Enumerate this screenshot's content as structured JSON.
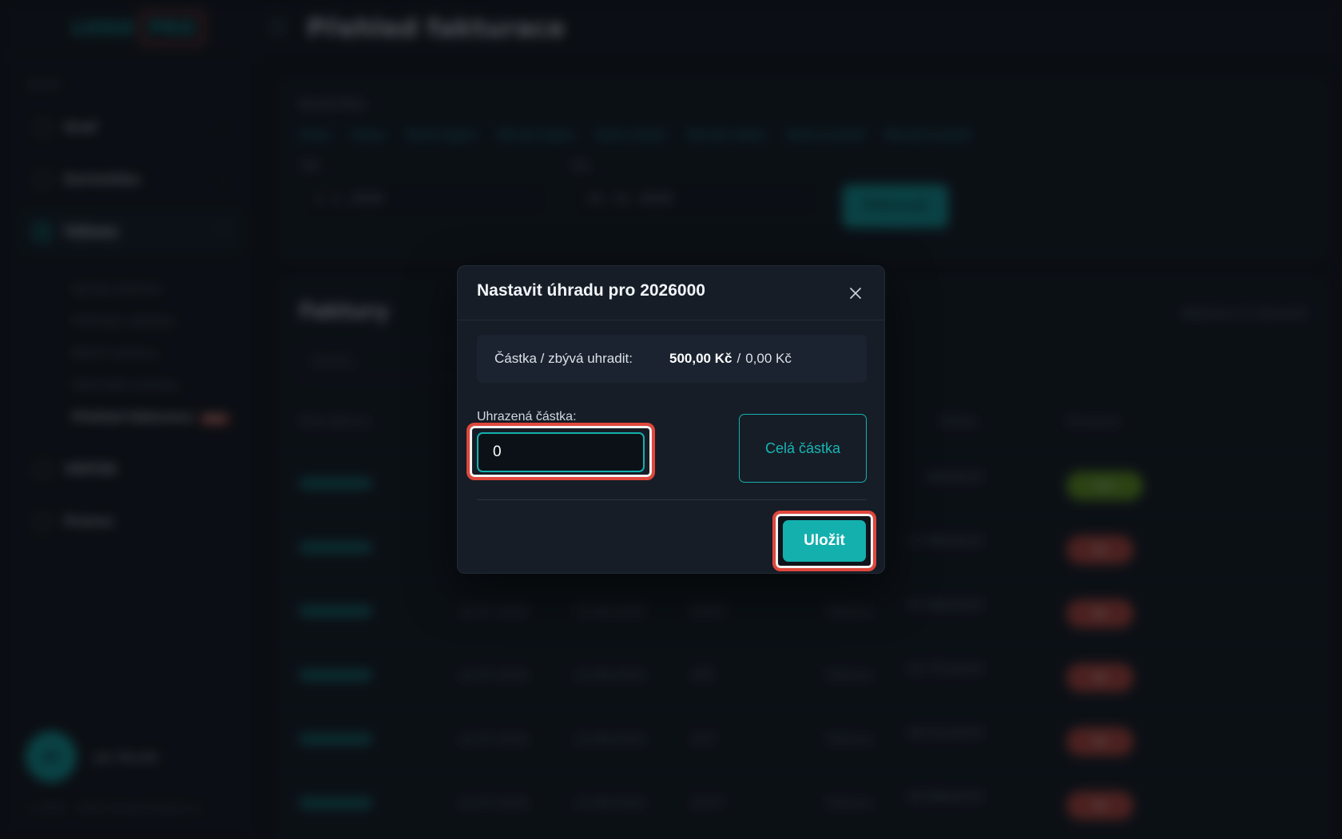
{
  "app": {
    "logo_text": "LOGO",
    "logo_badge": "PRO",
    "page_title": "Přehled fakturace"
  },
  "sidebar": {
    "section_label": "ADMIN",
    "items": [
      {
        "label": "Graf",
        "icon": "chart-icon"
      },
      {
        "label": "Kartotéka",
        "icon": "folder-icon"
      },
      {
        "label": "Výkazy",
        "icon": "report-icon"
      },
      {
        "label": "VRPÚD",
        "icon": "list-icon"
      },
      {
        "label": "Pomoc",
        "icon": "help-icon"
      }
    ],
    "sub_items": [
      {
        "label": "Rychlý přehled"
      },
      {
        "label": "Přehledy zakázky"
      },
      {
        "label": "Bloční sestavy"
      },
      {
        "label": "Obchodní sestavy"
      },
      {
        "label": "Přehled fakturace",
        "badge": "NEW"
      }
    ],
    "user": {
      "initials": "JN",
      "name": "Jan Novák"
    },
    "copyright": "© 2023 – 2026 Cloudovéřešení.cz"
  },
  "filters": {
    "quick_label": "Rychlé filtry",
    "quick_links": [
      "Dnes",
      "Včera",
      "Tento týden",
      "Minulý týden",
      "Tento měsíc",
      "Minulý měsíc",
      "Tento kvartál",
      "Minulý kvartál"
    ],
    "from_label": "Od:",
    "from_value": "1. 1. 2026",
    "to_label": "Do:",
    "to_value": "31. 12. 2026",
    "filter_button": "Filtrovat"
  },
  "invoices": {
    "title": "Faktury",
    "count": "Nalezeno 17 záznamů",
    "search_placeholder": "Hledat...",
    "columns": [
      "Číslo faktury",
      "Částka",
      "Uhrazeno"
    ],
    "rows": [
      {
        "col1": "",
        "col2": "",
        "col3": "",
        "type": "",
        "amount": "500,00 Kč",
        "status": "Ano",
        "status_color": "green"
      },
      {
        "col1": "",
        "col2": "",
        "col3": "",
        "type": "",
        "amount": "17 385,00 Kč",
        "status": "Ne",
        "status_color": "red"
      },
      {
        "col1": "22.07.2026",
        "col2": "22.08.2026",
        "col3": "ZHHV",
        "type": "Faktura",
        "amount": "41 000,00 Kč",
        "status": "Ne",
        "status_color": "red"
      },
      {
        "col1": "22.07.2026",
        "col2": "22.08.2026",
        "col3": "ZPE",
        "type": "Faktura",
        "amount": "41 770,00 Kč",
        "status": "Ne",
        "status_color": "red"
      },
      {
        "col1": "22.07.2026",
        "col2": "22.08.2026",
        "col3": "VCP",
        "type": "Faktura",
        "amount": "40 512,00 Kč",
        "status": "Ne",
        "status_color": "red"
      },
      {
        "col1": "22.07.2026",
        "col2": "22.08.2026",
        "col3": "VCCP",
        "type": "Faktura",
        "amount": "44 508,00 Kč",
        "status": "Ne",
        "status_color": "red"
      }
    ]
  },
  "modal": {
    "title": "Nastavit úhradu pro 2026000",
    "close_icon": "close-icon",
    "summary_label": "Částka / zbývá uhradit:",
    "summary_total": "500,00 Kč",
    "summary_separator": "/",
    "summary_remaining": "0,00 Kč",
    "paid_label": "Uhrazená částka:",
    "paid_value": "0",
    "full_amount_button": "Celá částka",
    "save_button": "Uložit"
  },
  "colors": {
    "accent": "#13b0ae",
    "highlight": "#e0473c",
    "background": "#0d1117"
  }
}
